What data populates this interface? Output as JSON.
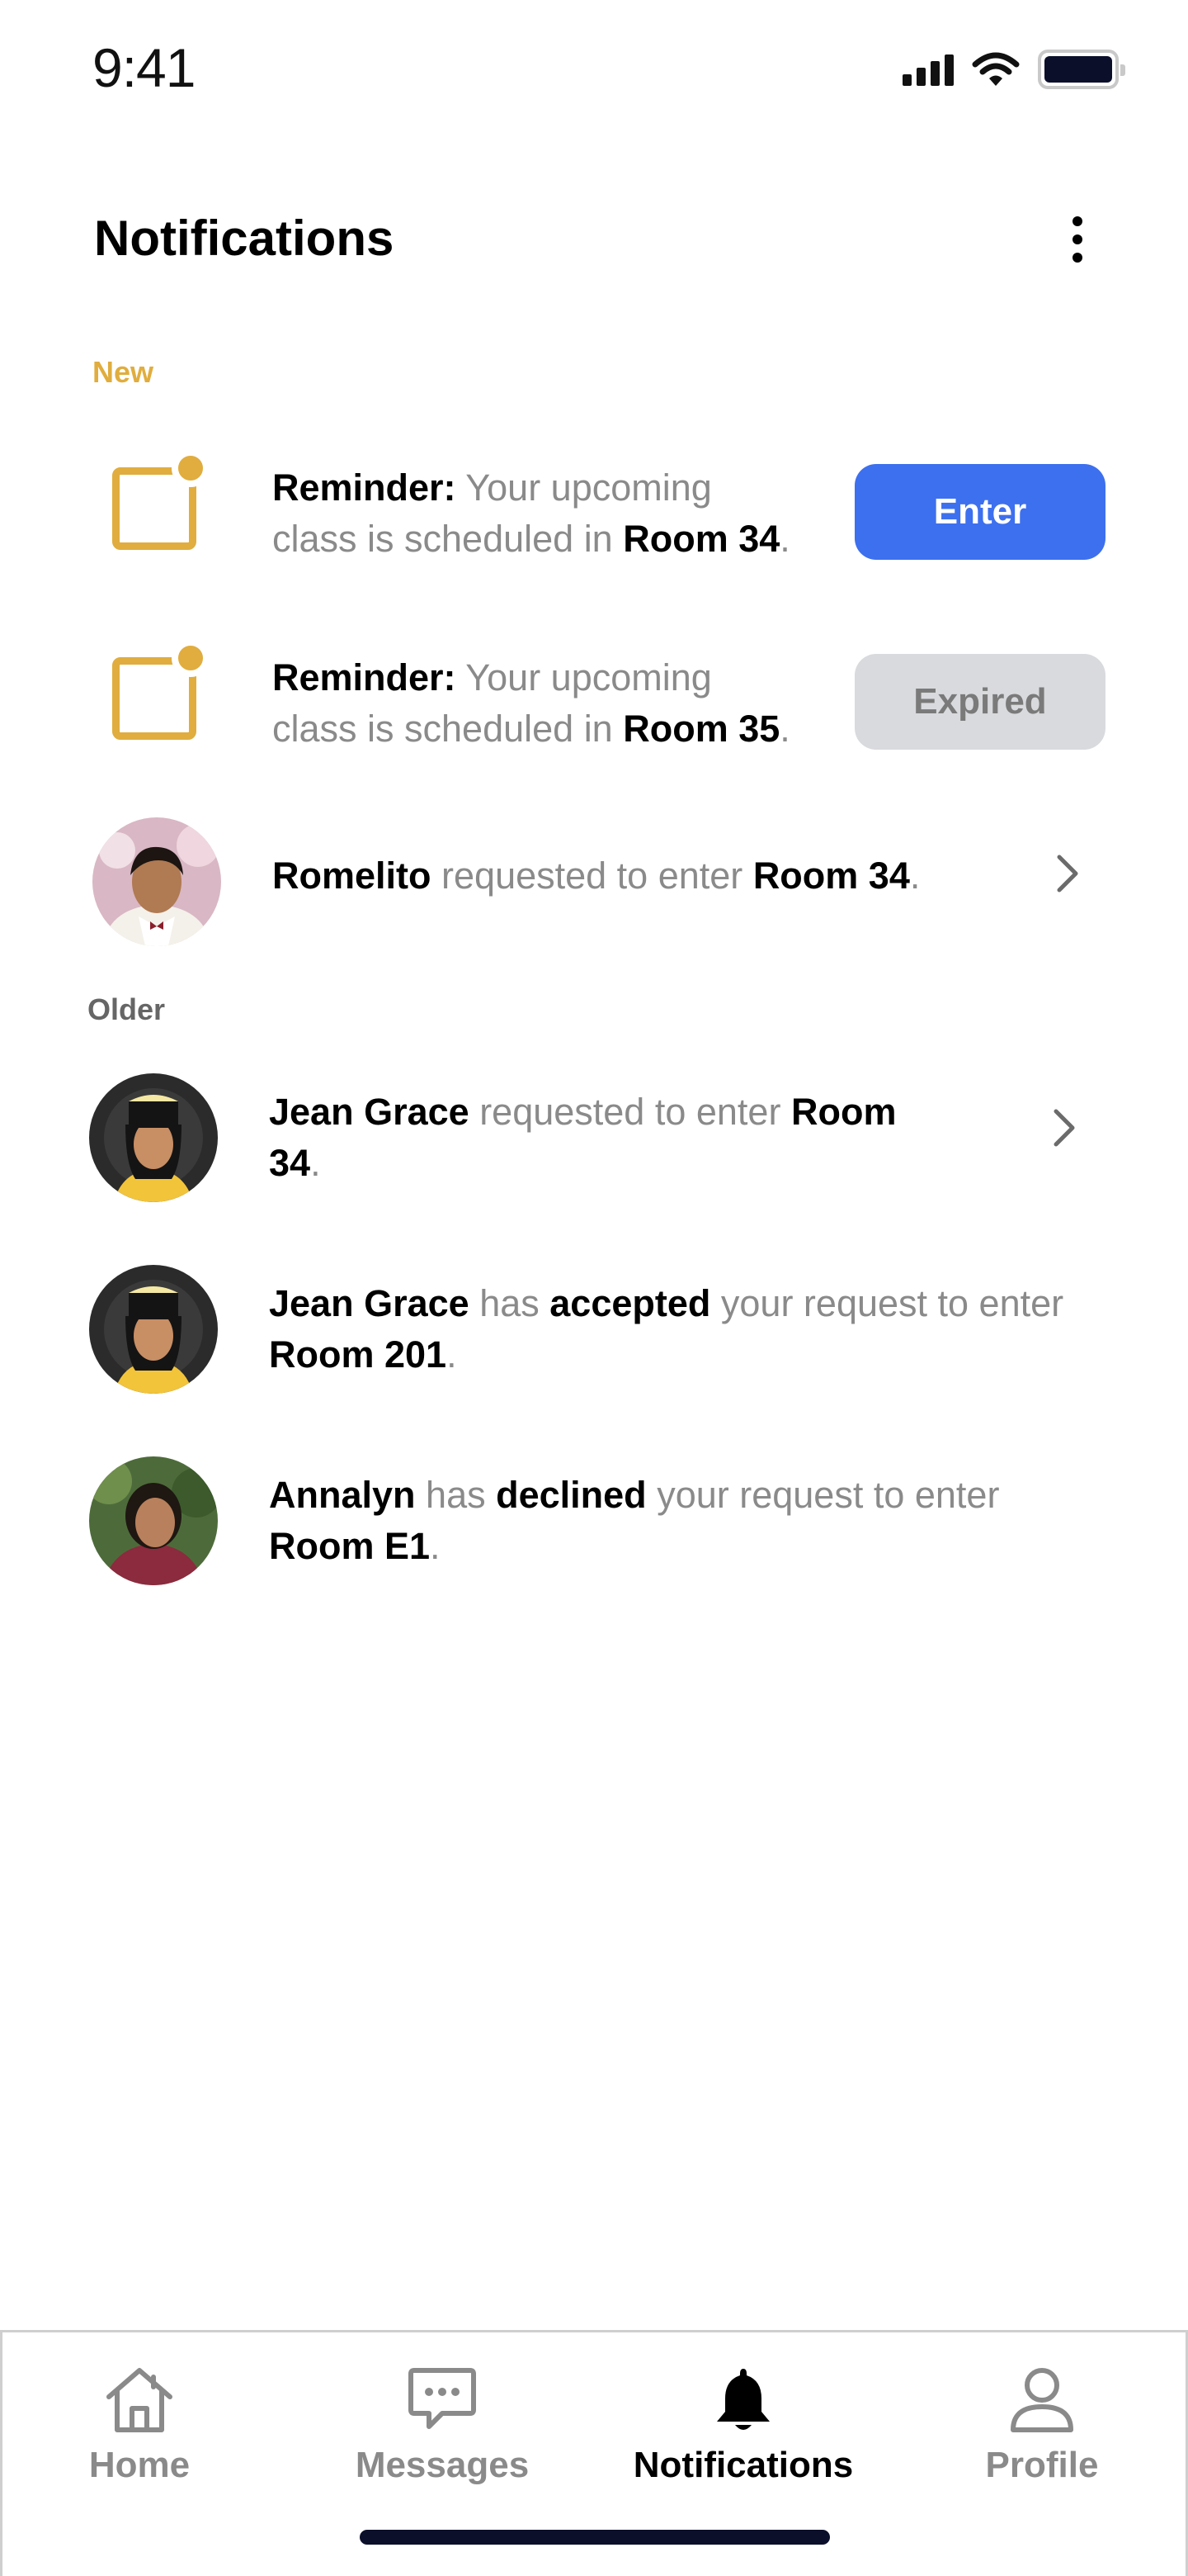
{
  "status_bar": {
    "time": "9:41"
  },
  "header": {
    "title": "Notifications"
  },
  "sections": {
    "new_label": "New",
    "older_label": "Older"
  },
  "notifications": {
    "reminder_1": {
      "label": "Reminder:",
      "text": "Your upcoming",
      "text2": "class is scheduled in",
      "room": "Room 34",
      "period": ".",
      "button": "Enter"
    },
    "reminder_2": {
      "label": "Reminder:",
      "text": "Your upcoming",
      "text2": "class is scheduled in",
      "room": "Room 35",
      "period": ".",
      "button": "Expired"
    },
    "request_romelito": {
      "name": "Romelito",
      "text": "requested to enter",
      "room": "Room 34",
      "period": "."
    },
    "request_jean": {
      "name": "Jean Grace",
      "text": "requested to enter",
      "room_a": "Room",
      "room_b": "34",
      "period": "."
    },
    "accepted_jean": {
      "name": "Jean Grace",
      "has": "has",
      "status": "accepted",
      "text": "your request to enter",
      "room": "Room 201",
      "period": "."
    },
    "declined_annalyn": {
      "name": "Annalyn",
      "has": "has",
      "status": "declined",
      "text": "your request to enter",
      "room": "Room E1",
      "period": "."
    }
  },
  "tab_bar": {
    "home": "Home",
    "messages": "Messages",
    "notifications": "Notifications",
    "profile": "Profile",
    "active": "notifications"
  },
  "colors": {
    "accent": "#e0ad3e",
    "primary_button": "#3d70ee",
    "disabled_button": "#d8dadd",
    "secondary_text": "#8a8a8a"
  },
  "icons": [
    "more-vertical-icon",
    "reminder-icon",
    "chevron-right-icon",
    "home-icon",
    "messages-icon",
    "bell-icon",
    "profile-icon",
    "signal-icon",
    "wifi-icon",
    "battery-icon"
  ]
}
